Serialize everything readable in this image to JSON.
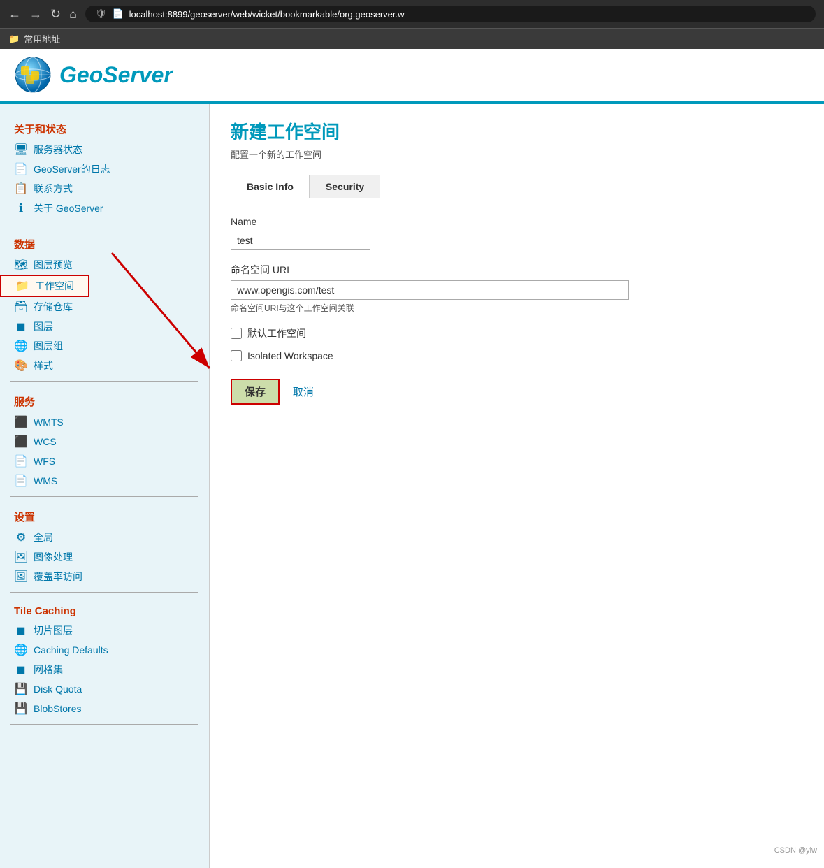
{
  "browser": {
    "nav_back": "←",
    "nav_forward": "→",
    "nav_refresh": "↻",
    "nav_home": "⌂",
    "url_display": "localhost:8899/geoserver/web/wicket/bookmarkable/org.geoserver.w",
    "bookmarks_label": "常用地址"
  },
  "header": {
    "logo_alt": "GeoServer",
    "title": "GeoServer"
  },
  "sidebar": {
    "section_about": "关于和状态",
    "items_about": [
      {
        "label": "服务器状态",
        "icon": "🖥"
      },
      {
        "label": "GeoServer的日志",
        "icon": "📄"
      },
      {
        "label": "联系方式",
        "icon": "📋"
      },
      {
        "label": "关于 GeoServer",
        "icon": "ℹ"
      }
    ],
    "section_data": "数据",
    "items_data": [
      {
        "label": "图层预览",
        "icon": "🗺",
        "selected": false
      },
      {
        "label": "工作空间",
        "icon": "📁",
        "selected": true
      },
      {
        "label": "存储仓库",
        "icon": "🗃"
      },
      {
        "label": "图层",
        "icon": "◼"
      },
      {
        "label": "图层组",
        "icon": "🌐"
      },
      {
        "label": "样式",
        "icon": "🎨"
      }
    ],
    "section_services": "服务",
    "items_services": [
      {
        "label": "WMTS",
        "icon": "⬛"
      },
      {
        "label": "WCS",
        "icon": "⬛"
      },
      {
        "label": "WFS",
        "icon": "📄"
      },
      {
        "label": "WMS",
        "icon": "📄"
      }
    ],
    "section_settings": "设置",
    "items_settings": [
      {
        "label": "全局",
        "icon": "⚙"
      },
      {
        "label": "图像处理",
        "icon": "🖼"
      },
      {
        "label": "覆盖率访问",
        "icon": "🖼"
      }
    ],
    "section_tile": "Tile Caching",
    "items_tile": [
      {
        "label": "切片图层",
        "icon": "◼"
      },
      {
        "label": "Caching Defaults",
        "icon": "🌐"
      },
      {
        "label": "网格集",
        "icon": "◼"
      },
      {
        "label": "Disk Quota",
        "icon": "💾"
      },
      {
        "label": "BlobStores",
        "icon": "💾"
      }
    ]
  },
  "content": {
    "page_title": "新建工作空间",
    "page_subtitle": "配置一个新的工作空间",
    "tabs": [
      {
        "label": "Basic Info",
        "active": true
      },
      {
        "label": "Security",
        "active": false
      }
    ],
    "form": {
      "name_label": "Name",
      "name_value": "test",
      "name_placeholder": "",
      "uri_label": "命名空间 URI",
      "uri_value": "www.opengis.com/test",
      "uri_hint": "命名空间URI与这个工作空间关联",
      "checkbox_default_label": "默认工作空间",
      "checkbox_isolated_label": "Isolated Workspace",
      "btn_save": "保存",
      "btn_cancel": "取消"
    }
  },
  "watermark": "CSDN @yiw"
}
